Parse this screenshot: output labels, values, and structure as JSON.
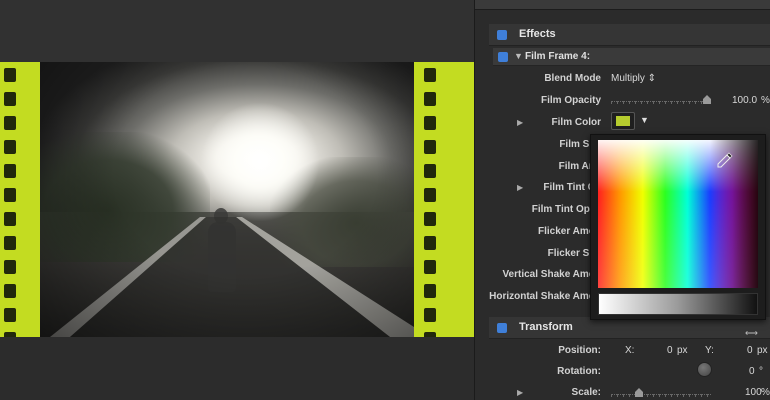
{
  "inspector": {
    "effects": {
      "title": "Effects"
    },
    "film_frame": {
      "title": "Film Frame 4:",
      "params": [
        {
          "label": "Blend Mode",
          "value": "Multiply ⇕"
        },
        {
          "label": "Film Opacity",
          "value": "100.0",
          "unit": "%",
          "slider_fraction": 1.0
        },
        {
          "label": "Film Color"
        },
        {
          "label": "Film Spe"
        },
        {
          "label": "Film Ang"
        },
        {
          "label": "Film Tint Co"
        },
        {
          "label": "Film Tint Opac"
        },
        {
          "label": "Flicker Amou"
        },
        {
          "label": "Flicker Spe"
        },
        {
          "label": "Vertical Shake Amou"
        },
        {
          "label": "Horizontal Shake Amou"
        }
      ],
      "film_color": "#b6cc2e"
    },
    "transform": {
      "title": "Transform",
      "position_label": "Position:",
      "x_label": "X:",
      "x_value": "0",
      "x_unit": "px",
      "y_label": "Y:",
      "y_value": "0",
      "y_unit": "px",
      "rotation_label": "Rotation:",
      "rotation_value": "0",
      "rotation_unit": "°",
      "scale_label": "Scale:",
      "scale_value": "100",
      "scale_unit": "%"
    }
  },
  "colors": {
    "accent": "#3f7fd9",
    "film_strip": "#c3dc21"
  },
  "icons": [
    "effects-checkbox-icon",
    "disclosure-triangle-icon",
    "eyedropper-icon",
    "transform-resize-icon"
  ]
}
